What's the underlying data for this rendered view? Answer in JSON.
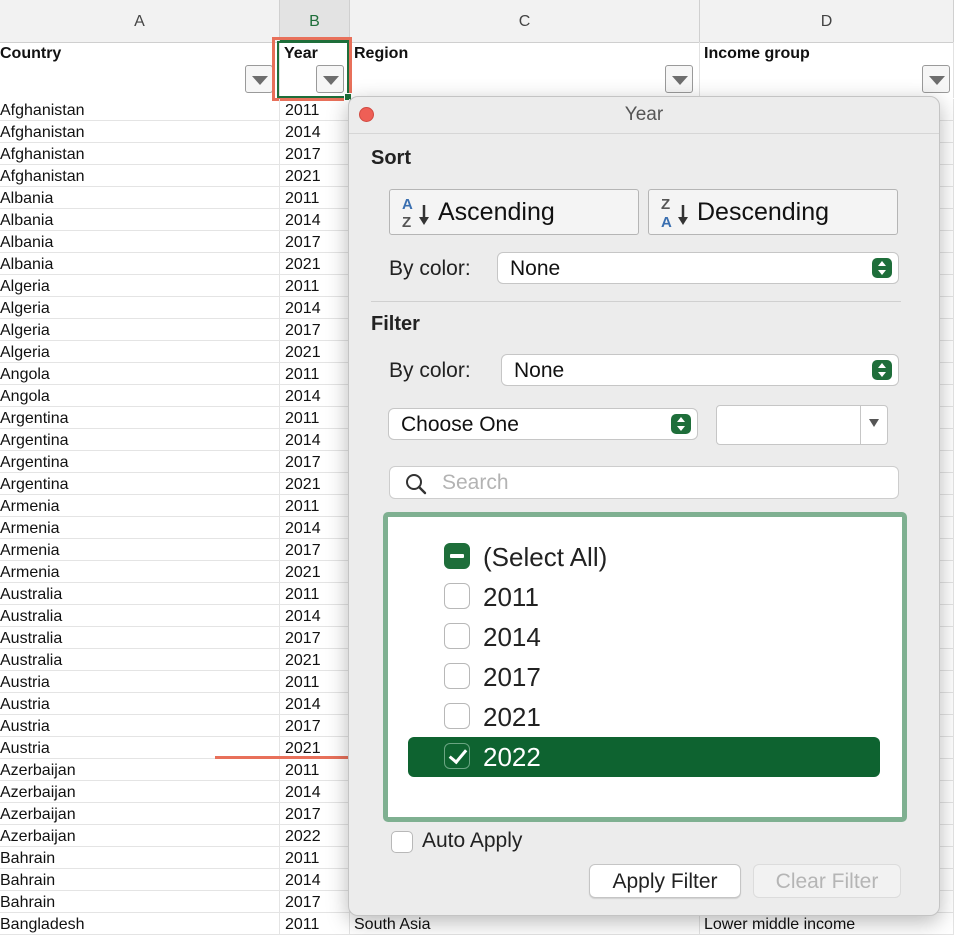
{
  "sheet": {
    "columns": [
      "A",
      "B",
      "C",
      "D"
    ],
    "headers": {
      "a": "Country",
      "b": "Year",
      "c": "Region",
      "d": "Income group"
    },
    "rows": [
      {
        "country": "Afghanistan",
        "year": "2011",
        "region": "",
        "income": ""
      },
      {
        "country": "Afghanistan",
        "year": "2014",
        "region": "",
        "income": ""
      },
      {
        "country": "Afghanistan",
        "year": "2017",
        "region": "",
        "income": ""
      },
      {
        "country": "Afghanistan",
        "year": "2021",
        "region": "",
        "income": ""
      },
      {
        "country": "Albania",
        "year": "2011",
        "region": "",
        "income": ""
      },
      {
        "country": "Albania",
        "year": "2014",
        "region": "",
        "income": ""
      },
      {
        "country": "Albania",
        "year": "2017",
        "region": "",
        "income": ""
      },
      {
        "country": "Albania",
        "year": "2021",
        "region": "",
        "income": ""
      },
      {
        "country": "Algeria",
        "year": "2011",
        "region": "",
        "income": ""
      },
      {
        "country": "Algeria",
        "year": "2014",
        "region": "",
        "income": ""
      },
      {
        "country": "Algeria",
        "year": "2017",
        "region": "",
        "income": ""
      },
      {
        "country": "Algeria",
        "year": "2021",
        "region": "",
        "income": ""
      },
      {
        "country": "Angola",
        "year": "2011",
        "region": "",
        "income": ""
      },
      {
        "country": "Angola",
        "year": "2014",
        "region": "",
        "income": ""
      },
      {
        "country": "Argentina",
        "year": "2011",
        "region": "",
        "income": ""
      },
      {
        "country": "Argentina",
        "year": "2014",
        "region": "",
        "income": ""
      },
      {
        "country": "Argentina",
        "year": "2017",
        "region": "",
        "income": ""
      },
      {
        "country": "Argentina",
        "year": "2021",
        "region": "",
        "income": ""
      },
      {
        "country": "Armenia",
        "year": "2011",
        "region": "",
        "income": ""
      },
      {
        "country": "Armenia",
        "year": "2014",
        "region": "",
        "income": ""
      },
      {
        "country": "Armenia",
        "year": "2017",
        "region": "",
        "income": ""
      },
      {
        "country": "Armenia",
        "year": "2021",
        "region": "",
        "income": ""
      },
      {
        "country": "Australia",
        "year": "2011",
        "region": "",
        "income": ""
      },
      {
        "country": "Australia",
        "year": "2014",
        "region": "",
        "income": ""
      },
      {
        "country": "Australia",
        "year": "2017",
        "region": "",
        "income": ""
      },
      {
        "country": "Australia",
        "year": "2021",
        "region": "",
        "income": ""
      },
      {
        "country": "Austria",
        "year": "2011",
        "region": "",
        "income": ""
      },
      {
        "country": "Austria",
        "year": "2014",
        "region": "",
        "income": ""
      },
      {
        "country": "Austria",
        "year": "2017",
        "region": "",
        "income": ""
      },
      {
        "country": "Austria",
        "year": "2021",
        "region": "",
        "income": ""
      },
      {
        "country": "Azerbaijan",
        "year": "2011",
        "region": "",
        "income": ""
      },
      {
        "country": "Azerbaijan",
        "year": "2014",
        "region": "",
        "income": ""
      },
      {
        "country": "Azerbaijan",
        "year": "2017",
        "region": "",
        "income": ""
      },
      {
        "country": "Azerbaijan",
        "year": "2022",
        "region": "",
        "income": ""
      },
      {
        "country": "Bahrain",
        "year": "2011",
        "region": "",
        "income": ""
      },
      {
        "country": "Bahrain",
        "year": "2014",
        "region": "",
        "income": ""
      },
      {
        "country": "Bahrain",
        "year": "2017",
        "region": "",
        "income": ""
      },
      {
        "country": "Bangladesh",
        "year": "2011",
        "region": "South Asia",
        "income": "Lower middle income"
      }
    ]
  },
  "popup": {
    "title": "Year",
    "sort_heading": "Sort",
    "ascending_label": "Ascending",
    "descending_label": "Descending",
    "sort_bycolor_label": "By color:",
    "sort_bycolor_value": "None",
    "filter_heading": "Filter",
    "filter_bycolor_label": "By color:",
    "filter_bycolor_value": "None",
    "choose_value": "Choose One",
    "search_placeholder": "Search",
    "list": [
      {
        "label": "(Select All)",
        "state": "mixed"
      },
      {
        "label": "2011",
        "state": "unchecked"
      },
      {
        "label": "2014",
        "state": "unchecked"
      },
      {
        "label": "2017",
        "state": "unchecked"
      },
      {
        "label": "2021",
        "state": "unchecked"
      },
      {
        "label": "2022",
        "state": "checked"
      }
    ],
    "auto_apply_label": "Auto Apply",
    "apply_label": "Apply Filter",
    "clear_label": "Clear Filter"
  },
  "colors": {
    "accent": "#1e6e3a",
    "selected_row": "#0e6330",
    "annotation": "#e8705a",
    "list_border": "#7fb091"
  }
}
